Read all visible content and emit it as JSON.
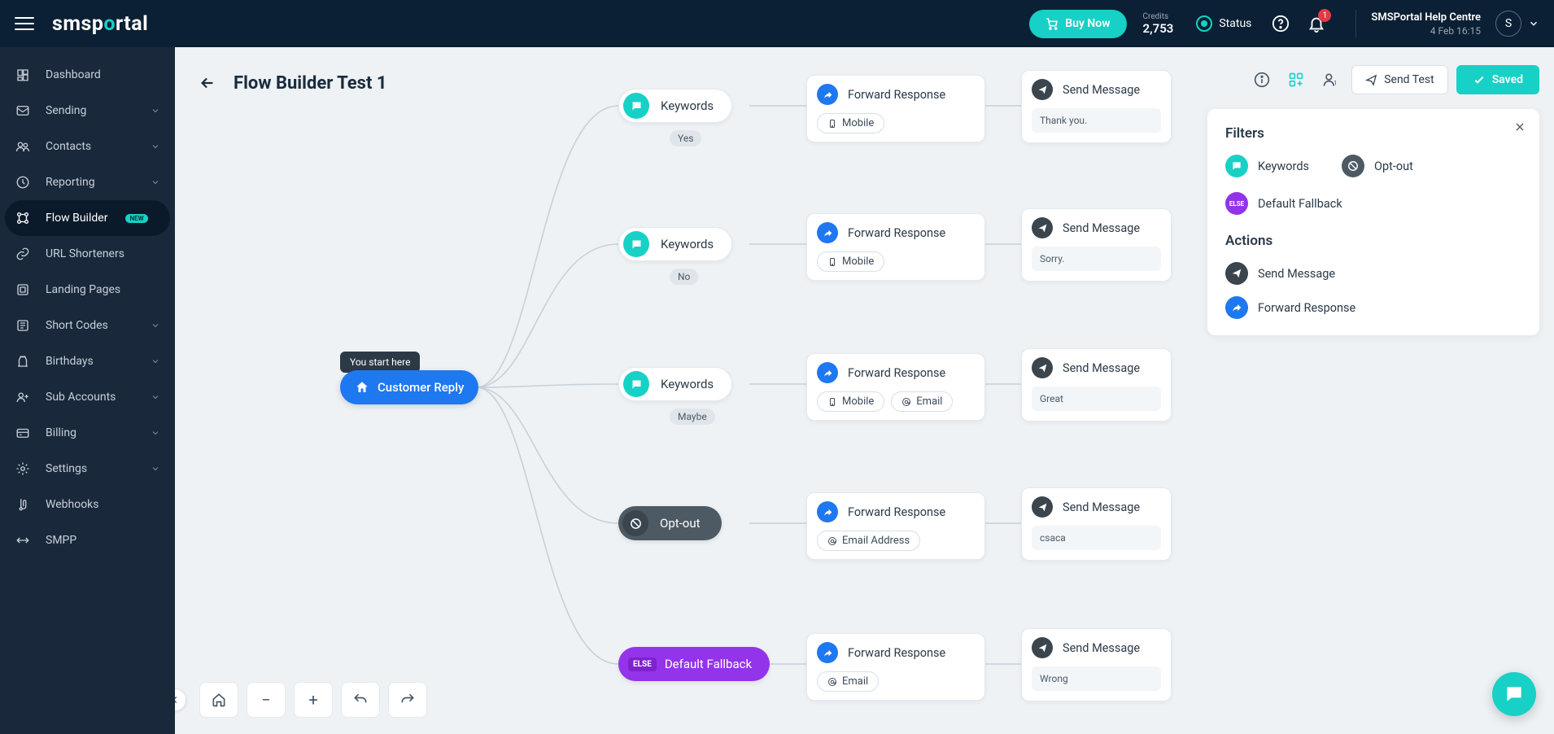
{
  "header": {
    "brand_prefix": "sms",
    "brand_mid1": "p",
    "brand_dot": "o",
    "brand_mid2": "",
    "brand_suffix": "rtal",
    "buy_label": "Buy Now",
    "credits_label": "Credits",
    "credits_value": "2,753",
    "status_label": "Status",
    "notifications_count": "1",
    "help_title": "SMSPortal Help Centre",
    "help_date": "4 Feb 16:15",
    "avatar_initial": "S"
  },
  "nav": {
    "items": [
      {
        "label": "Dashboard",
        "expandable": false
      },
      {
        "label": "Sending",
        "expandable": true
      },
      {
        "label": "Contacts",
        "expandable": true
      },
      {
        "label": "Reporting",
        "expandable": true
      },
      {
        "label": "Flow Builder",
        "expandable": false,
        "badge": "NEW",
        "active": true
      },
      {
        "label": "URL Shorteners",
        "expandable": false
      },
      {
        "label": "Landing Pages",
        "expandable": false
      },
      {
        "label": "Short Codes",
        "expandable": true
      },
      {
        "label": "Birthdays",
        "expandable": true
      },
      {
        "label": "Sub Accounts",
        "expandable": true
      },
      {
        "label": "Billing",
        "expandable": true
      },
      {
        "label": "Settings",
        "expandable": true
      },
      {
        "label": "Webhooks",
        "expandable": false
      },
      {
        "label": "SMPP",
        "expandable": false
      }
    ]
  },
  "page": {
    "title": "Flow Builder Test 1",
    "start_hint": "You start here",
    "root_label": "Customer Reply"
  },
  "flow": {
    "branches": [
      {
        "type": "keywords",
        "label": "Keywords",
        "tag": "Yes",
        "forward": {
          "title": "Forward Response",
          "chips": [
            "Mobile"
          ]
        },
        "send": {
          "title": "Send Message",
          "body": "Thank you."
        }
      },
      {
        "type": "keywords",
        "label": "Keywords",
        "tag": "No",
        "forward": {
          "title": "Forward Response",
          "chips": [
            "Mobile"
          ]
        },
        "send": {
          "title": "Send Message",
          "body": "Sorry."
        }
      },
      {
        "type": "keywords",
        "label": "Keywords",
        "tag": "Maybe",
        "forward": {
          "title": "Forward Response",
          "chips": [
            "Mobile",
            "Email"
          ]
        },
        "send": {
          "title": "Send Message",
          "body": "Great"
        }
      },
      {
        "type": "optout",
        "label": "Opt-out",
        "forward": {
          "title": "Forward Response",
          "chips": [
            "Email Address"
          ]
        },
        "send": {
          "title": "Send Message",
          "body": "csaca"
        }
      },
      {
        "type": "fallback",
        "label": "Default Fallback",
        "else": "ELSE",
        "forward": {
          "title": "Forward Response",
          "chips": [
            "Email"
          ]
        },
        "send": {
          "title": "Send Message",
          "body": "Wrong"
        }
      }
    ]
  },
  "toolbar": {
    "send_test": "Send Test",
    "saved": "Saved"
  },
  "palette": {
    "filters_title": "Filters",
    "actions_title": "Actions",
    "keywords": "Keywords",
    "optout": "Opt-out",
    "fallback": "Default Fallback",
    "fallback_badge": "ELSE",
    "send_message": "Send Message",
    "forward_response": "Forward Response"
  }
}
